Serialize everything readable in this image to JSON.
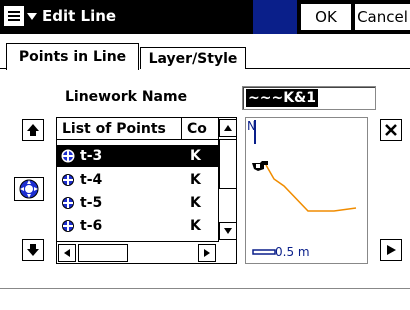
{
  "window": {
    "title": "Edit Line",
    "ok_label": "OK",
    "cancel_label": "Cancel"
  },
  "tabs": [
    {
      "label": "Points in Line",
      "active": true
    },
    {
      "label": "Layer/Style",
      "active": false
    }
  ],
  "linework": {
    "label": "Linework Name",
    "value": "~~~K&1"
  },
  "points_list": {
    "header_points": "List of Points",
    "header_code": "Co",
    "rows": [
      {
        "name": "t-3",
        "code": "K",
        "selected": true
      },
      {
        "name": "t-4",
        "code": "K",
        "selected": false
      },
      {
        "name": "t-5",
        "code": "K",
        "selected": false
      },
      {
        "name": "t-6",
        "code": "K",
        "selected": false
      }
    ]
  },
  "map_preview": {
    "north_label": "N",
    "scale_label": "0.5 m",
    "line_color": "#f08c00",
    "accent_color": "#0a1f8a"
  }
}
